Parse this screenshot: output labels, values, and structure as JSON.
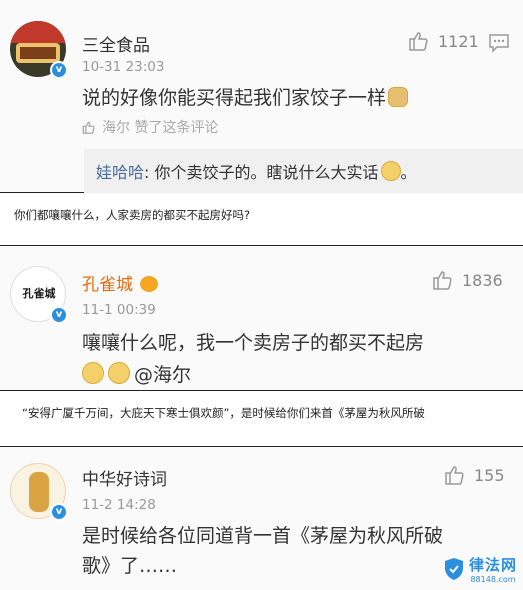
{
  "comments": [
    {
      "name": "三全食品",
      "time": "10-31 23:03",
      "text": "说的好像你能买得起我们家饺子一样",
      "likes": "1121",
      "liked_by": "海尔 赞了这条评论",
      "reply": {
        "user": "娃哈哈",
        "text": ": 你个卖饺子的。瞎说什么大实话"
      }
    },
    {
      "name": "孔雀城",
      "avatar_text": "孔雀城",
      "time": "11-1 00:39",
      "text_line1": "嚷嚷什么呢，我一个卖房子的都买不起房",
      "text_line2": "@海尔",
      "likes": "1836"
    },
    {
      "name": "中华好诗词",
      "time": "11-2 14:28",
      "text_line1": "是时候给各位同道背一首《茅屋为秋风所破",
      "text_line2": "歌》了……",
      "likes": "155"
    }
  ],
  "captions": {
    "first": "你们都嚷嚷什么，人家卖房的都买不起房好吗?",
    "second": "“安得广厦千万间，大庇天下寒士俱欢颜”，是时候给你们来首《茅屋为秋风所破"
  },
  "watermark": {
    "title": "律法网",
    "sub": "88148.com"
  },
  "colors": {
    "verified": "#2b8fe0",
    "orange_name": "#e8690b",
    "reply_user": "#4a6c9a"
  }
}
